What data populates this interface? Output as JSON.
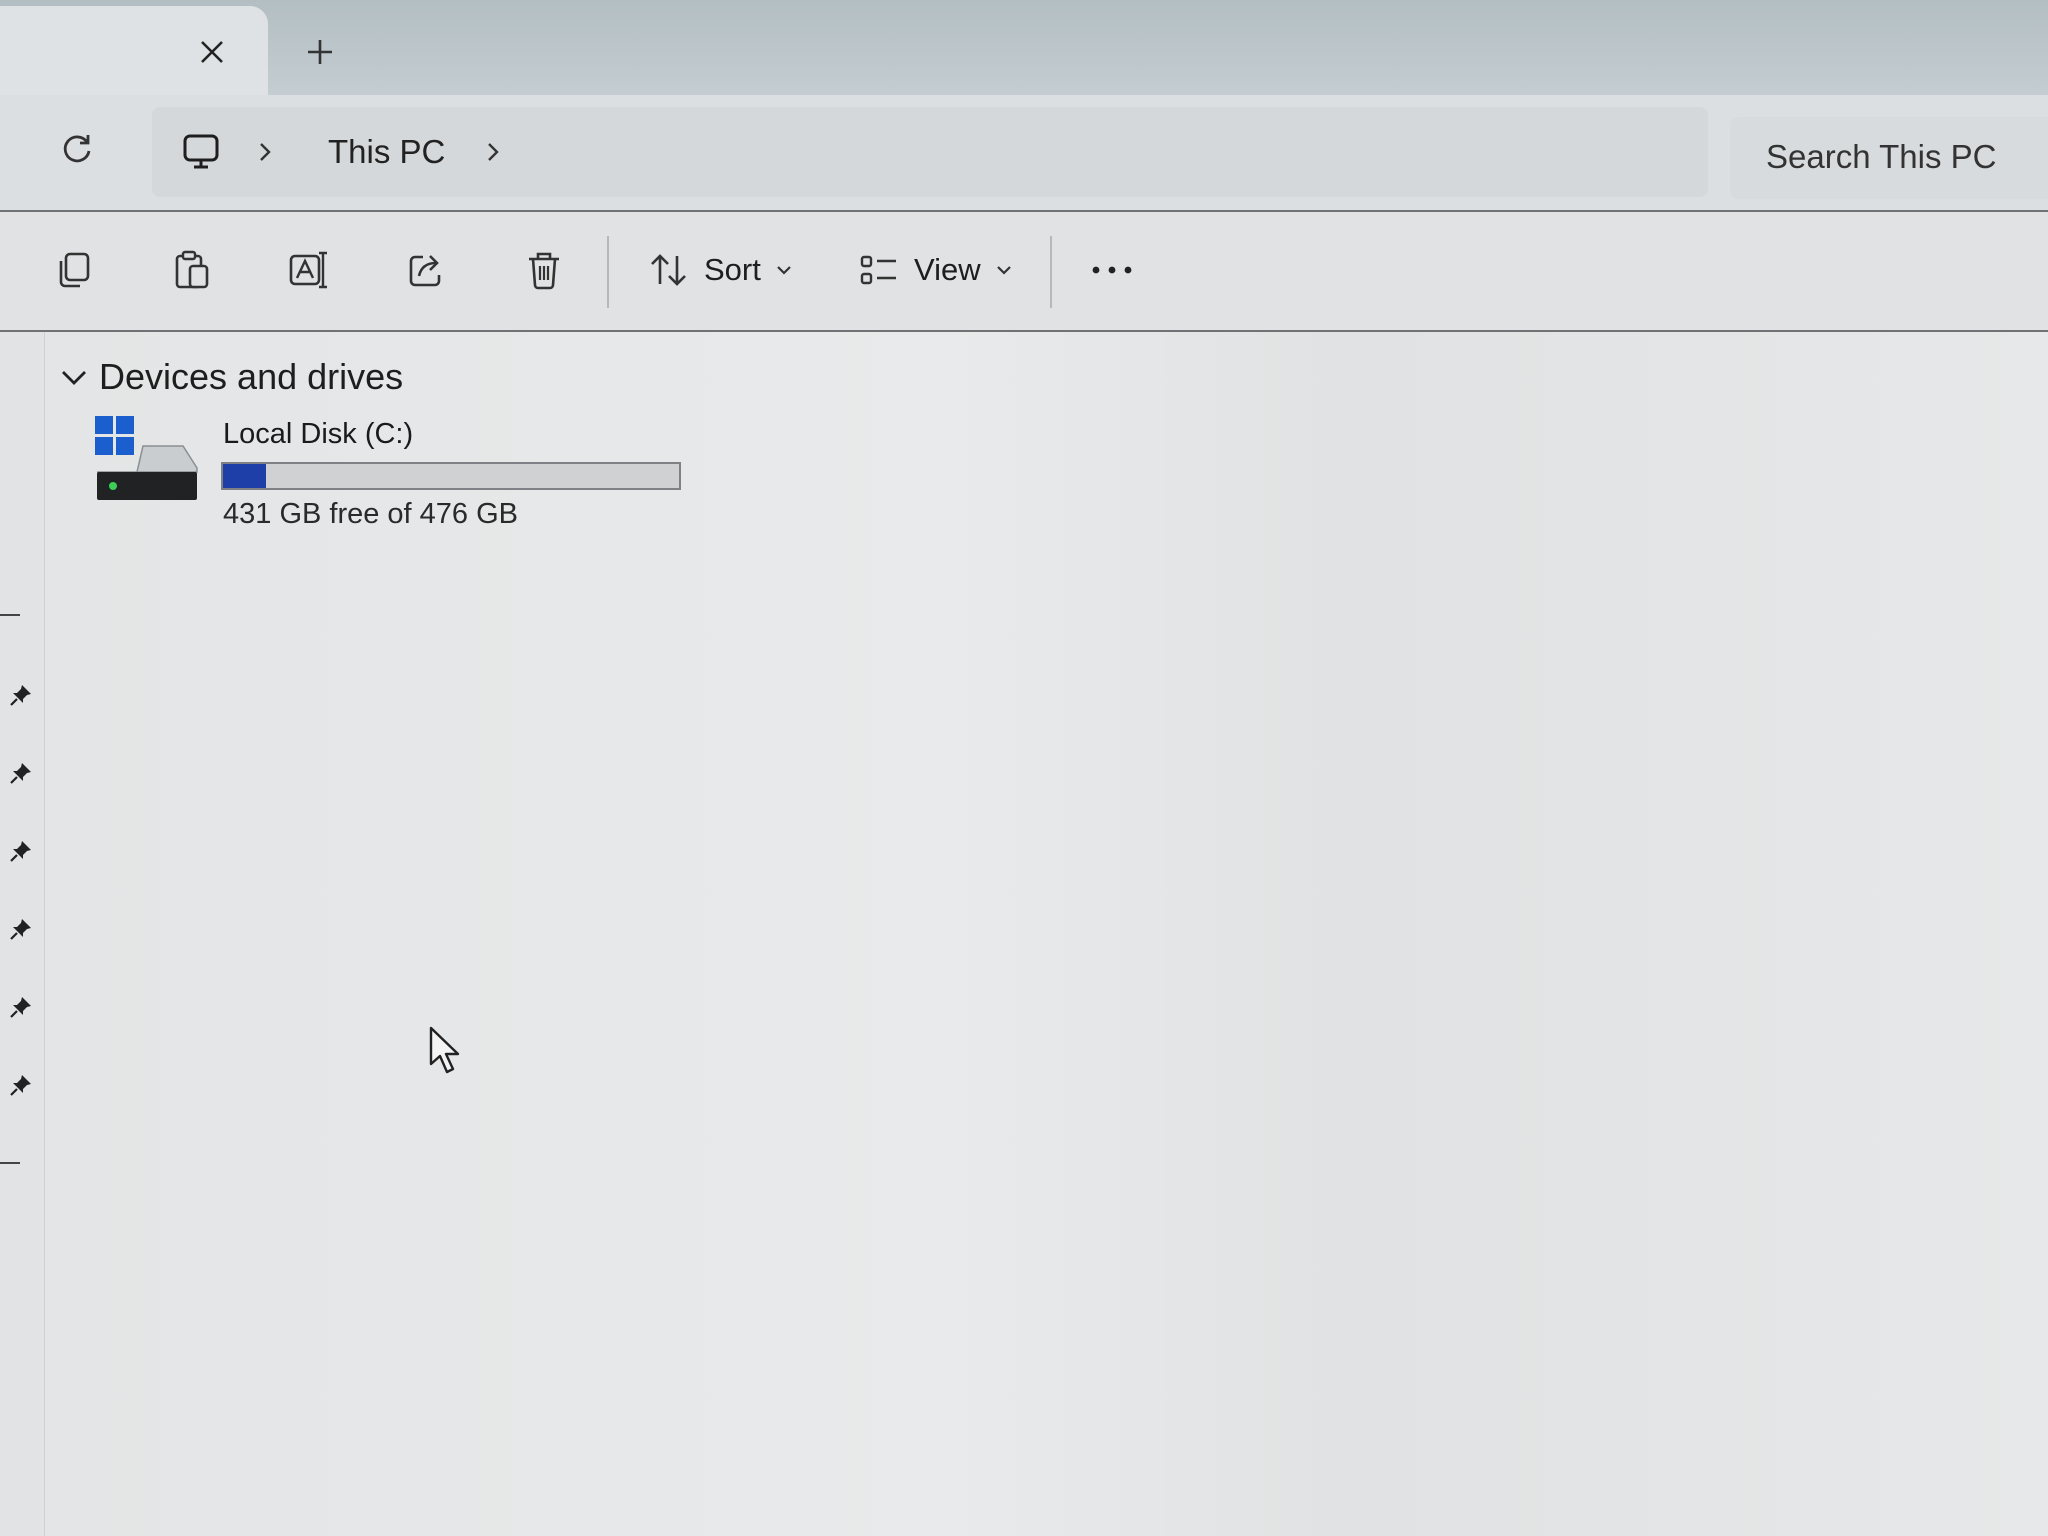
{
  "tabs": {
    "close_icon": "close-icon",
    "new_tab_icon": "plus-icon"
  },
  "address_bar": {
    "refresh_icon": "refresh-icon",
    "location_icon": "computer-icon",
    "breadcrumb": [
      "This PC"
    ],
    "search_placeholder": "Search This PC"
  },
  "command_bar": {
    "icon_buttons": [
      "copy-icon",
      "paste-icon",
      "rename-icon",
      "share-icon",
      "delete-icon"
    ],
    "sort": {
      "label": "Sort",
      "icon": "sort-icon"
    },
    "view": {
      "label": "View",
      "icon": "view-list-icon"
    },
    "more_icon": "more-icon"
  },
  "main": {
    "group_title": "Devices and drives",
    "drives": [
      {
        "name": "Local Disk (C:)",
        "free_text": "431 GB free of 476 GB",
        "free_gb": 431,
        "total_gb": 476,
        "used_fraction": 0.095
      }
    ]
  },
  "colors": {
    "usage_bar": "#1e3fa8",
    "windows_logo": "#1b5fcf"
  }
}
